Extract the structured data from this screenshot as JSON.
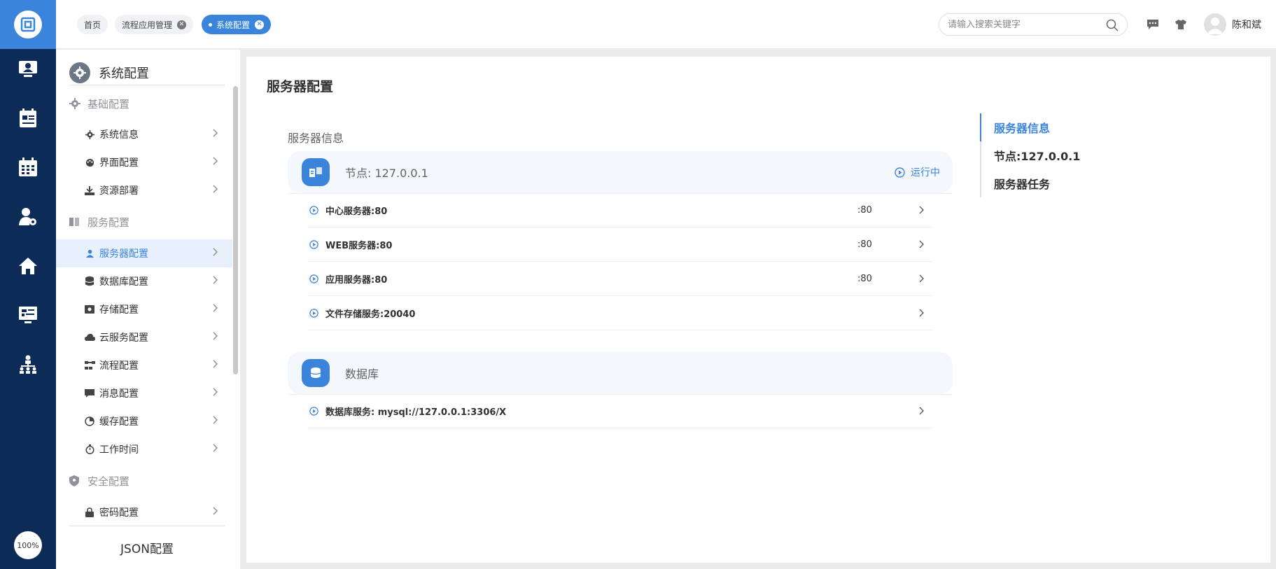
{
  "rail": {
    "zoom_label": "100%",
    "icons": [
      "monitor-user-icon",
      "form-list-icon",
      "calendar-icon",
      "user-settings-icon",
      "home-icon",
      "dashboard-icon",
      "org-chart-icon"
    ]
  },
  "topbar": {
    "tabs": [
      {
        "label": "首页",
        "closable": false,
        "active": false
      },
      {
        "label": "流程应用管理",
        "closable": true,
        "active": false
      },
      {
        "label": "系统配置",
        "closable": true,
        "active": true
      }
    ],
    "search_placeholder": "请输入搜索关键字",
    "username": "陈和斌"
  },
  "sidebar": {
    "title": "系统配置",
    "groups": [
      {
        "label": "基础配置",
        "items": [
          "系统信息",
          "界面配置",
          "资源部署"
        ]
      },
      {
        "label": "服务配置",
        "items": [
          "服务器配置",
          "数据库配置",
          "存储配置",
          "云服务配置",
          "流程配置",
          "消息配置",
          "缓存配置",
          "工作时间"
        ]
      },
      {
        "label": "安全配置",
        "items": [
          "密码配置"
        ]
      }
    ],
    "active_item": "服务器配置",
    "footer": "JSON配置"
  },
  "main": {
    "page_title": "服务器配置",
    "section_title": "服务器信息",
    "node_panel": {
      "title": "节点: 127.0.0.1",
      "status": "运行中",
      "rows": [
        {
          "label": "中心服务器:80",
          "port": ":80"
        },
        {
          "label": "WEB服务器:80",
          "port": ":80"
        },
        {
          "label": "应用服务器:80",
          "port": ":80"
        },
        {
          "label": "文件存储服务:20040",
          "port": ""
        }
      ]
    },
    "db_panel": {
      "title": "数据库",
      "rows": [
        {
          "label": "数据库服务: mysql://127.0.0.1:3306/X",
          "port": ""
        }
      ]
    },
    "anchors": [
      "服务器信息",
      "节点:127.0.0.1",
      "服务器任务"
    ]
  },
  "colors": {
    "accent": "#3a84dc",
    "rail_bg": "#0d2b57",
    "panel_bg": "#f4f8fd"
  }
}
